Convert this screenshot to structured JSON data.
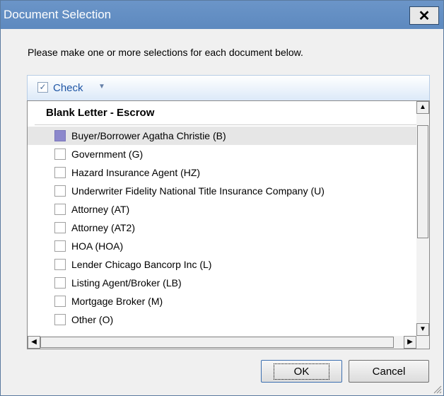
{
  "window": {
    "title": "Document Selection",
    "close_glyph": "✕"
  },
  "instruction": "Please make one or more selections for each document below.",
  "toolbar": {
    "check_label": "Check",
    "check_icon": "checkbox-icon",
    "dropdown_icon": "chevron-down-icon"
  },
  "list": {
    "header": "Blank Letter - Escrow",
    "items": [
      {
        "label": "Buyer/Borrower Agatha Christie (B)",
        "selected": true
      },
      {
        "label": "Government (G)",
        "selected": false
      },
      {
        "label": "Hazard Insurance Agent (HZ)",
        "selected": false
      },
      {
        "label": "Underwriter Fidelity National Title Insurance Company (U)",
        "selected": false
      },
      {
        "label": "Attorney (AT)",
        "selected": false
      },
      {
        "label": "Attorney (AT2)",
        "selected": false
      },
      {
        "label": "HOA (HOA)",
        "selected": false
      },
      {
        "label": "Lender Chicago Bancorp Inc (L)",
        "selected": false
      },
      {
        "label": "Listing Agent/Broker (LB)",
        "selected": false
      },
      {
        "label": "Mortgage Broker (M)",
        "selected": false
      },
      {
        "label": "Other (O)",
        "selected": false
      }
    ]
  },
  "buttons": {
    "ok": "OK",
    "cancel": "Cancel"
  },
  "colors": {
    "title_bar": "#6b95c8",
    "selected_checkbox": "#8c88cc",
    "toolbar_text": "#1f56a5"
  }
}
